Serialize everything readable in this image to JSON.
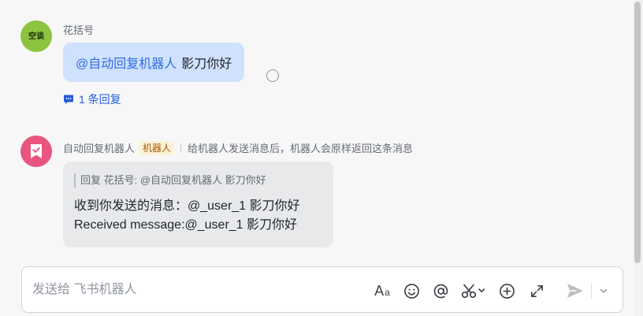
{
  "messages": [
    {
      "avatar_text": "空谈",
      "sender": "花括号",
      "mention": "@自动回复机器人",
      "text": "影刀你好",
      "reply_link": "1 条回复"
    },
    {
      "sender": "自动回复机器人",
      "bot_tag": "机器人",
      "bot_description": "给机器人发送消息后，机器人会原样返回这条消息",
      "quote": "回复 花括号: @自动回复机器人 影刀你好",
      "lines": [
        "收到你发送的消息：@_user_1 影刀你好",
        "Received message:@_user_1 影刀你好"
      ]
    }
  ],
  "composer": {
    "placeholder": "发送给 飞书机器人",
    "value": ""
  },
  "toolbar": {
    "font_label": "A",
    "font_small": "a",
    "icons": [
      "font-format-icon",
      "emoji-icon",
      "at-icon",
      "scissors-icon",
      "plus-circle-icon",
      "expand-icon",
      "send-icon",
      "chevron-down-icon"
    ]
  },
  "colors": {
    "accent": "#245bdb",
    "my_bubble": "#cfe1fc",
    "bot_bubble": "#e8e9eb",
    "avatar_user": "#8cc43f",
    "avatar_bot": "#e8557f"
  }
}
